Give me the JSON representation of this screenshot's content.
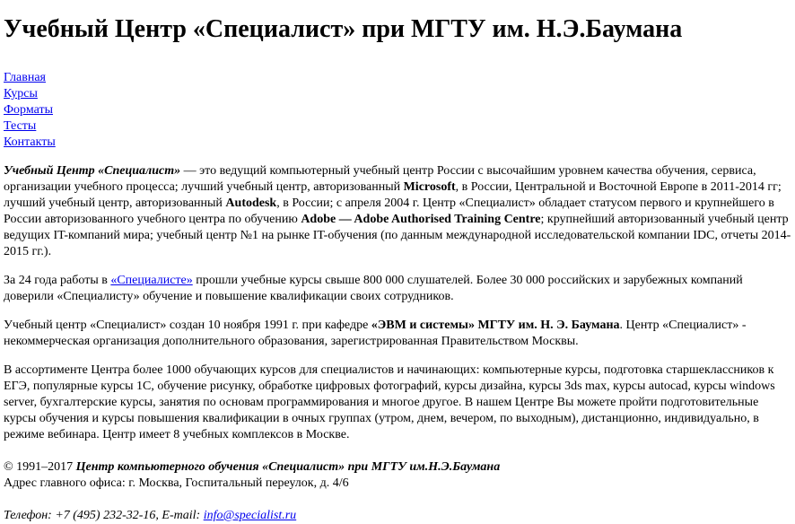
{
  "header": {
    "title": "Учебный Центр «Специалист» при МГТУ им. Н.Э.Баумана"
  },
  "nav": {
    "items": [
      {
        "label": "Главная"
      },
      {
        "label": "Курсы"
      },
      {
        "label": "Форматы"
      },
      {
        "label": "Тесты"
      },
      {
        "label": "Контакты"
      }
    ]
  },
  "content": {
    "p1": {
      "center_name": "Учебный Центр «Специалист»",
      "t1": " — это ведущий компьютерный учебный центр России с высочайшим уровнем качества обучения, сервиса, организации учебного процесса; лучший учебный центр, авторизованный ",
      "microsoft": "Microsoft",
      "t2": ", в России, Центральной и Восточной Европе в 2011-2014 гг; лучший учебный центр, авторизованный ",
      "autodesk": "Autodesk",
      "t3": ", в России; с апреля 2004 г. Центр «Специалист» обладает статусом первого и крупнейшего в России авторизованного учебного центра по обучению ",
      "adobe": "Adobe — Adobe Authorised Training Centre",
      "t4": "; крупнейший авторизованный учебный центр ведущих IT-компаний мира; учебный центр №1 на рынке IT-обучения (по данным международной исследовательской компании IDC, отчеты 2014-2015 гг.)."
    },
    "p2": {
      "t1": "За 24 года работы в ",
      "link": "«Специалисте»",
      "t2": " прошли учебные курсы свыше 800 000 слушателей. Более 30 000 российских и зарубежных компаний доверили «Специалисту» обучение и повышение квалификации своих сотрудников."
    },
    "p3": {
      "t1": "Учебный центр «Специалист» создан 10 ноября 1991 г. при кафедре ",
      "dept": "«ЭВМ и системы» МГТУ им. Н. Э. Баумана",
      "t2": ". Центр «Специалист» - некоммерческая организация дополнительного образования, зарегистрированная Правительством Москвы."
    },
    "p4": "В ассортименте Центра более 1000 обучающих курсов для специалистов и начинающих: компьютерные курсы, подготовка старшеклассников к ЕГЭ, популярные курсы 1С, обучение рисунку, обработке цифровых фотографий, курсы дизайна, курсы 3ds max, курсы autocad, курсы windows server, бухгалтерские курсы, занятия по основам программирования и многое другое. В нашем Центре Вы можете пройти подготовительные курсы обучения и курсы повышения квалификации в очных группах (утром, днем, вечером, по выходным), дистанционно, индивидуально, в режиме вебинара. Центр имеет 8 учебных комплексов в Москве."
  },
  "footer": {
    "copyright": "© 1991–2017 ",
    "org": "Центр компьютерного обучения «Специалист» при МГТУ им.Н.Э.Баумана",
    "address": "Адрес главного офиса: г. Москва, Госпитальный переулок, д. 4/6",
    "phone_text": "Телефон: +7 (495) 232-32-16, E-mail: ",
    "email": "info@specialist.ru"
  }
}
